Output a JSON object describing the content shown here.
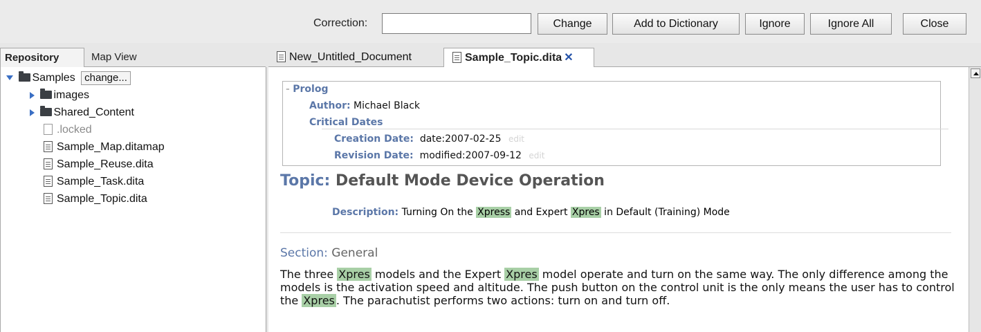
{
  "toolbar": {
    "correction_label": "Correction:",
    "correction_value": "",
    "change_label": "Change",
    "add_dict_label": "Add to Dictionary",
    "ignore_label": "Ignore",
    "ignore_all_label": "Ignore All",
    "close_label": "Close"
  },
  "left_tabs": {
    "repository": "Repository",
    "map_view": "Map View"
  },
  "tree": {
    "root": "Samples",
    "change_button": "change...",
    "folders": [
      "images",
      "Shared_Content"
    ],
    "locked": ".locked",
    "files": [
      "Sample_Map.ditamap",
      "Sample_Reuse.dita",
      "Sample_Task.dita",
      "Sample_Topic.dita"
    ]
  },
  "editor_tabs": [
    "New_Untitled_Document",
    "Sample_Topic.dita"
  ],
  "prolog": {
    "heading": "Prolog",
    "author_label": "Author:",
    "author_value": "Michael Black",
    "critical_dates": "Critical Dates",
    "creation_label": "Creation Date:",
    "creation_value": "date:2007-02-25",
    "revision_label": "Revision Date:",
    "revision_value": "modified:2007-09-12",
    "edit_link": "edit"
  },
  "topic": {
    "label": "Topic:",
    "title": "Default Mode Device Operation",
    "desc_label": "Description:",
    "desc_parts": [
      "Turning On the ",
      "Xpress",
      " and Expert ",
      "Xpres",
      " in Default (Training) Mode"
    ]
  },
  "section": {
    "label": "Section:",
    "title": "General",
    "para_parts": [
      "The three ",
      "Xpres",
      " models and the Expert ",
      "Xpres",
      " model operate and turn on the same way. The only difference among the models is the activation speed and altitude. The push button on the control unit is the only means the user has to control the ",
      "Xpres",
      ". The parachutist performs two actions: turn on and turn off."
    ]
  }
}
